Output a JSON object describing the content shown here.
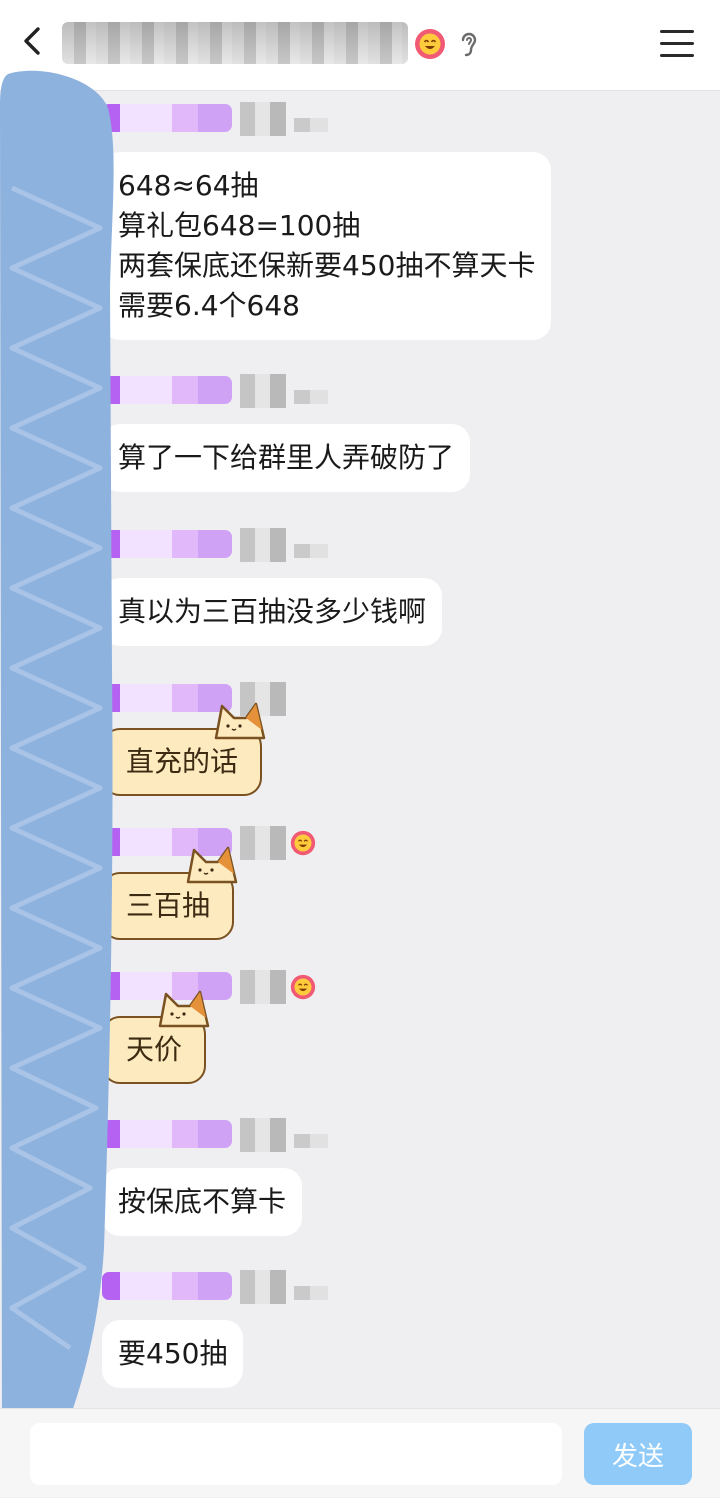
{
  "messages": [
    {
      "text": "648≈64抽\n算礼包648=100抽\n两套保底还保新要450抽不算天卡\n需要6.4个648",
      "style": "bubble"
    },
    {
      "text": "算了一下给群里人弄破防了",
      "style": "bubble"
    },
    {
      "text": "真以为三百抽没多少钱啊",
      "style": "bubble"
    },
    {
      "text": "直充的话",
      "style": "cat"
    },
    {
      "text": "三百抽",
      "style": "cat"
    },
    {
      "text": "天价",
      "style": "cat"
    },
    {
      "text": "按保底不算卡",
      "style": "bubble"
    },
    {
      "text": "要450抽",
      "style": "bubble"
    }
  ],
  "input": {
    "placeholder": "",
    "value": ""
  },
  "send_label": "发送",
  "colors": {
    "accent_send": "#8fcaf9",
    "cat_bubble_fill": "#fdebbf",
    "cat_bubble_border": "#7a5222",
    "scribble": "#8eb2de"
  },
  "icons": [
    "back-icon",
    "level-badge-icon",
    "ear-icon",
    "menu-icon",
    "send-icon"
  ]
}
